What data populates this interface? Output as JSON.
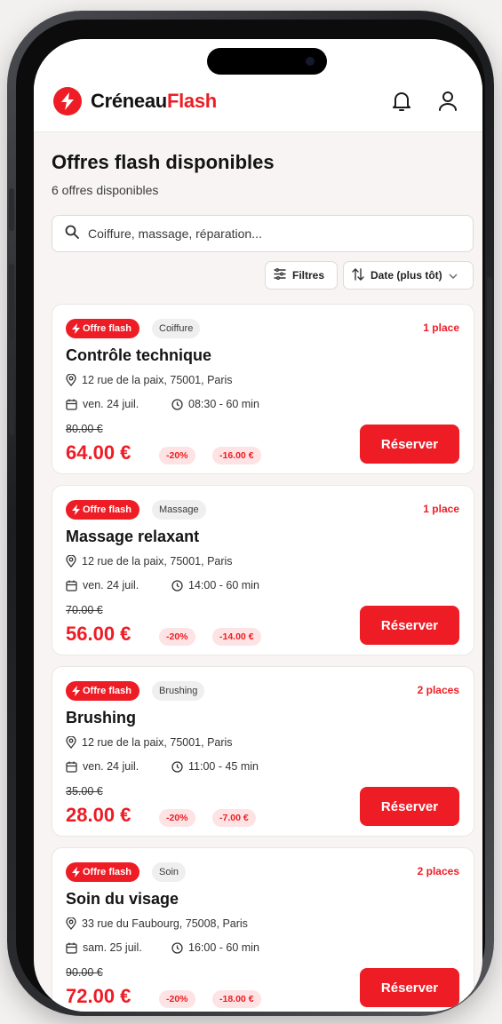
{
  "header": {
    "logo_part1": "Créneau",
    "logo_part2": "Flash",
    "bell_icon": "bell-icon",
    "user_icon": "user-icon",
    "accent_color": "#ee1c25"
  },
  "main": {
    "title": "Offres flash disponibles",
    "subtitle": "6 offres disponibles",
    "search_placeholder": "Coiffure, massage, réparation...",
    "filters_label": "Filtres",
    "sort_label": "Date (plus tôt)"
  },
  "offers": [
    {
      "flash_label": "Offre flash",
      "category": "Coiffure",
      "places": "1 place",
      "title": "Contrôle technique",
      "address": "12 rue de la paix, 75001, Paris",
      "date": "ven. 24 juil.",
      "time": "08:30 - 60 min",
      "old_price": "80.00 €",
      "new_price": "64.00 €",
      "discount_pct": "-20%",
      "discount_amt": "-16.00 €",
      "cta": "Réserver"
    },
    {
      "flash_label": "Offre flash",
      "category": "Massage",
      "places": "1 place",
      "title": "Massage relaxant",
      "address": "12 rue de la paix, 75001, Paris",
      "date": "ven. 24 juil.",
      "time": "14:00 - 60 min",
      "old_price": "70.00 €",
      "new_price": "56.00 €",
      "discount_pct": "-20%",
      "discount_amt": "-14.00 €",
      "cta": "Réserver"
    },
    {
      "flash_label": "Offre flash",
      "category": "Brushing",
      "places": "2 places",
      "title": "Brushing",
      "address": "12 rue de la paix, 75001, Paris",
      "date": "ven. 24 juil.",
      "time": "11:00 - 45 min",
      "old_price": "35.00 €",
      "new_price": "28.00 €",
      "discount_pct": "-20%",
      "discount_amt": "-7.00 €",
      "cta": "Réserver"
    },
    {
      "flash_label": "Offre flash",
      "category": "Soin",
      "places": "2 places",
      "title": "Soin du visage",
      "address": "33 rue du Faubourg, 75008, Paris",
      "date": "sam. 25 juil.",
      "time": "16:00 - 60 min",
      "old_price": "90.00 €",
      "new_price": "72.00 €",
      "discount_pct": "-20%",
      "discount_amt": "-18.00 €",
      "cta": "Réserver"
    }
  ]
}
